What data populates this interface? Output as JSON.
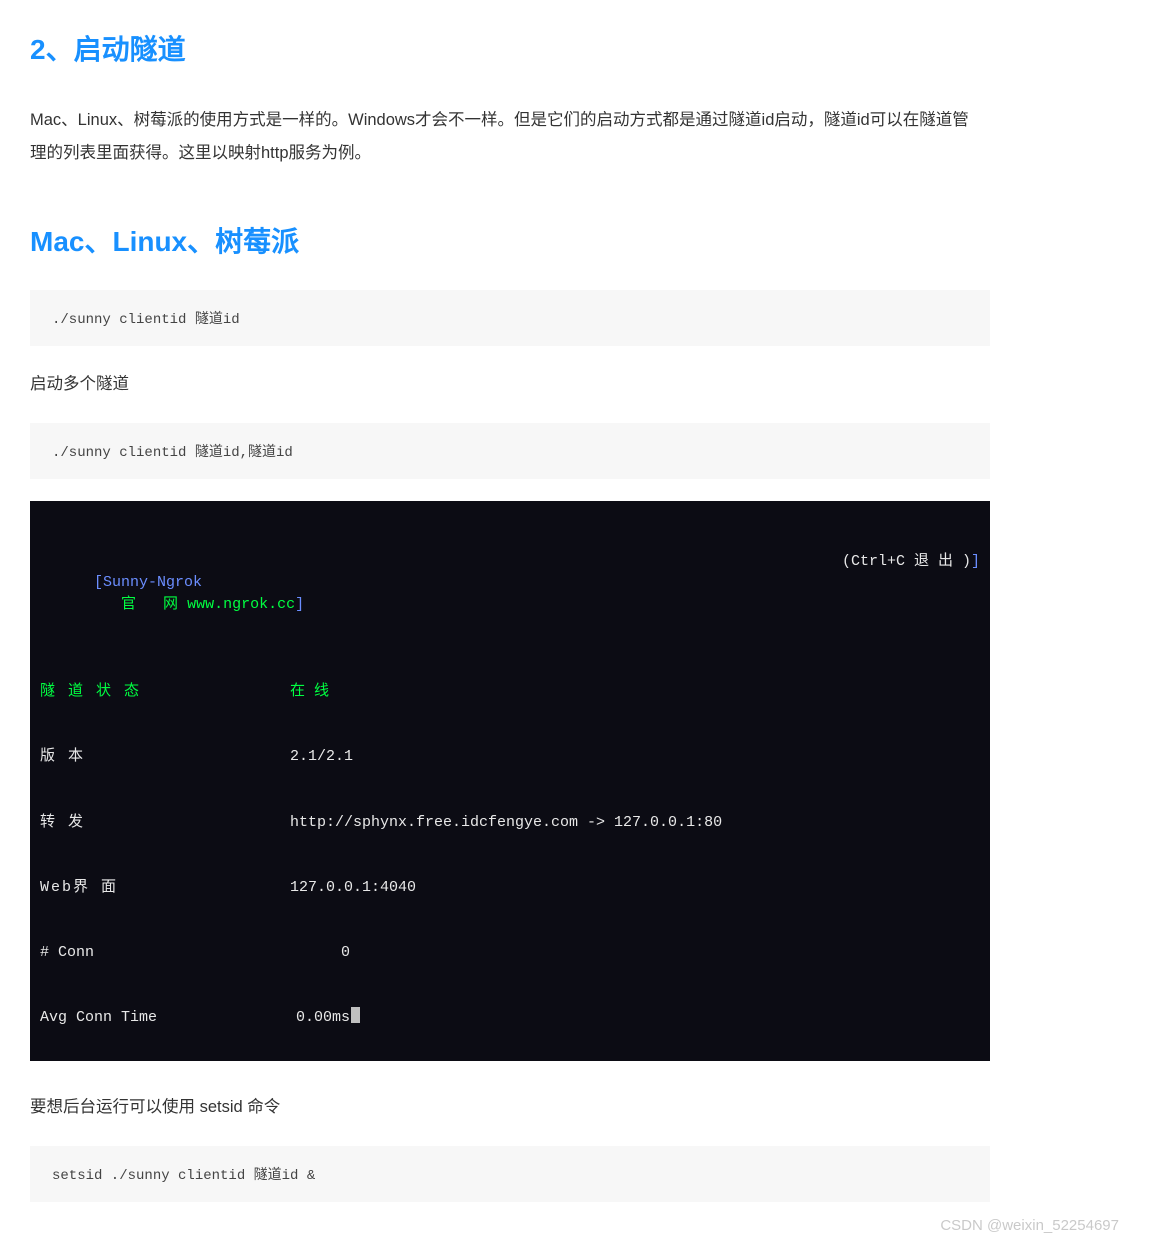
{
  "section1": {
    "heading": "2、启动隧道",
    "intro": "Mac、Linux、树莓派的使用方式是一样的。Windows才会不一样。但是它们的启动方式都是通过隧道id启动，隧道id可以在隧道管理的列表里面获得。这里以映射http服务为例。"
  },
  "section2": {
    "heading": "Mac、Linux、树莓派",
    "code1": "./sunny clientid 隧道id",
    "multi_text": "启动多个隧道",
    "code2": "./sunny clientid 隧道id,隧道id",
    "bg_text": "要想后台运行可以使用 setsid 命令",
    "code3": "setsid ./sunny clientid 隧道id &"
  },
  "terminal": {
    "brand": "Sunny-Ngrok",
    "brand_label": "官   网",
    "brand_url": "www.ngrok.cc",
    "exit_hint": "(Ctrl+C 退 出 )",
    "rows": {
      "status_label": "隧 道 状 态",
      "status_value": "在 线",
      "version_label": "版 本",
      "version_value": "2.1/2.1",
      "forward_label": "转 发",
      "forward_value": "http://sphynx.free.idcfengye.com -> 127.0.0.1:80",
      "web_label": "Web界 面",
      "web_value": "127.0.0.1:4040",
      "conn_label": "# Conn",
      "conn_value": "0",
      "avg_label": "Avg Conn Time",
      "avg_value": "0.00ms"
    }
  },
  "watermark": "CSDN @weixin_52254697"
}
